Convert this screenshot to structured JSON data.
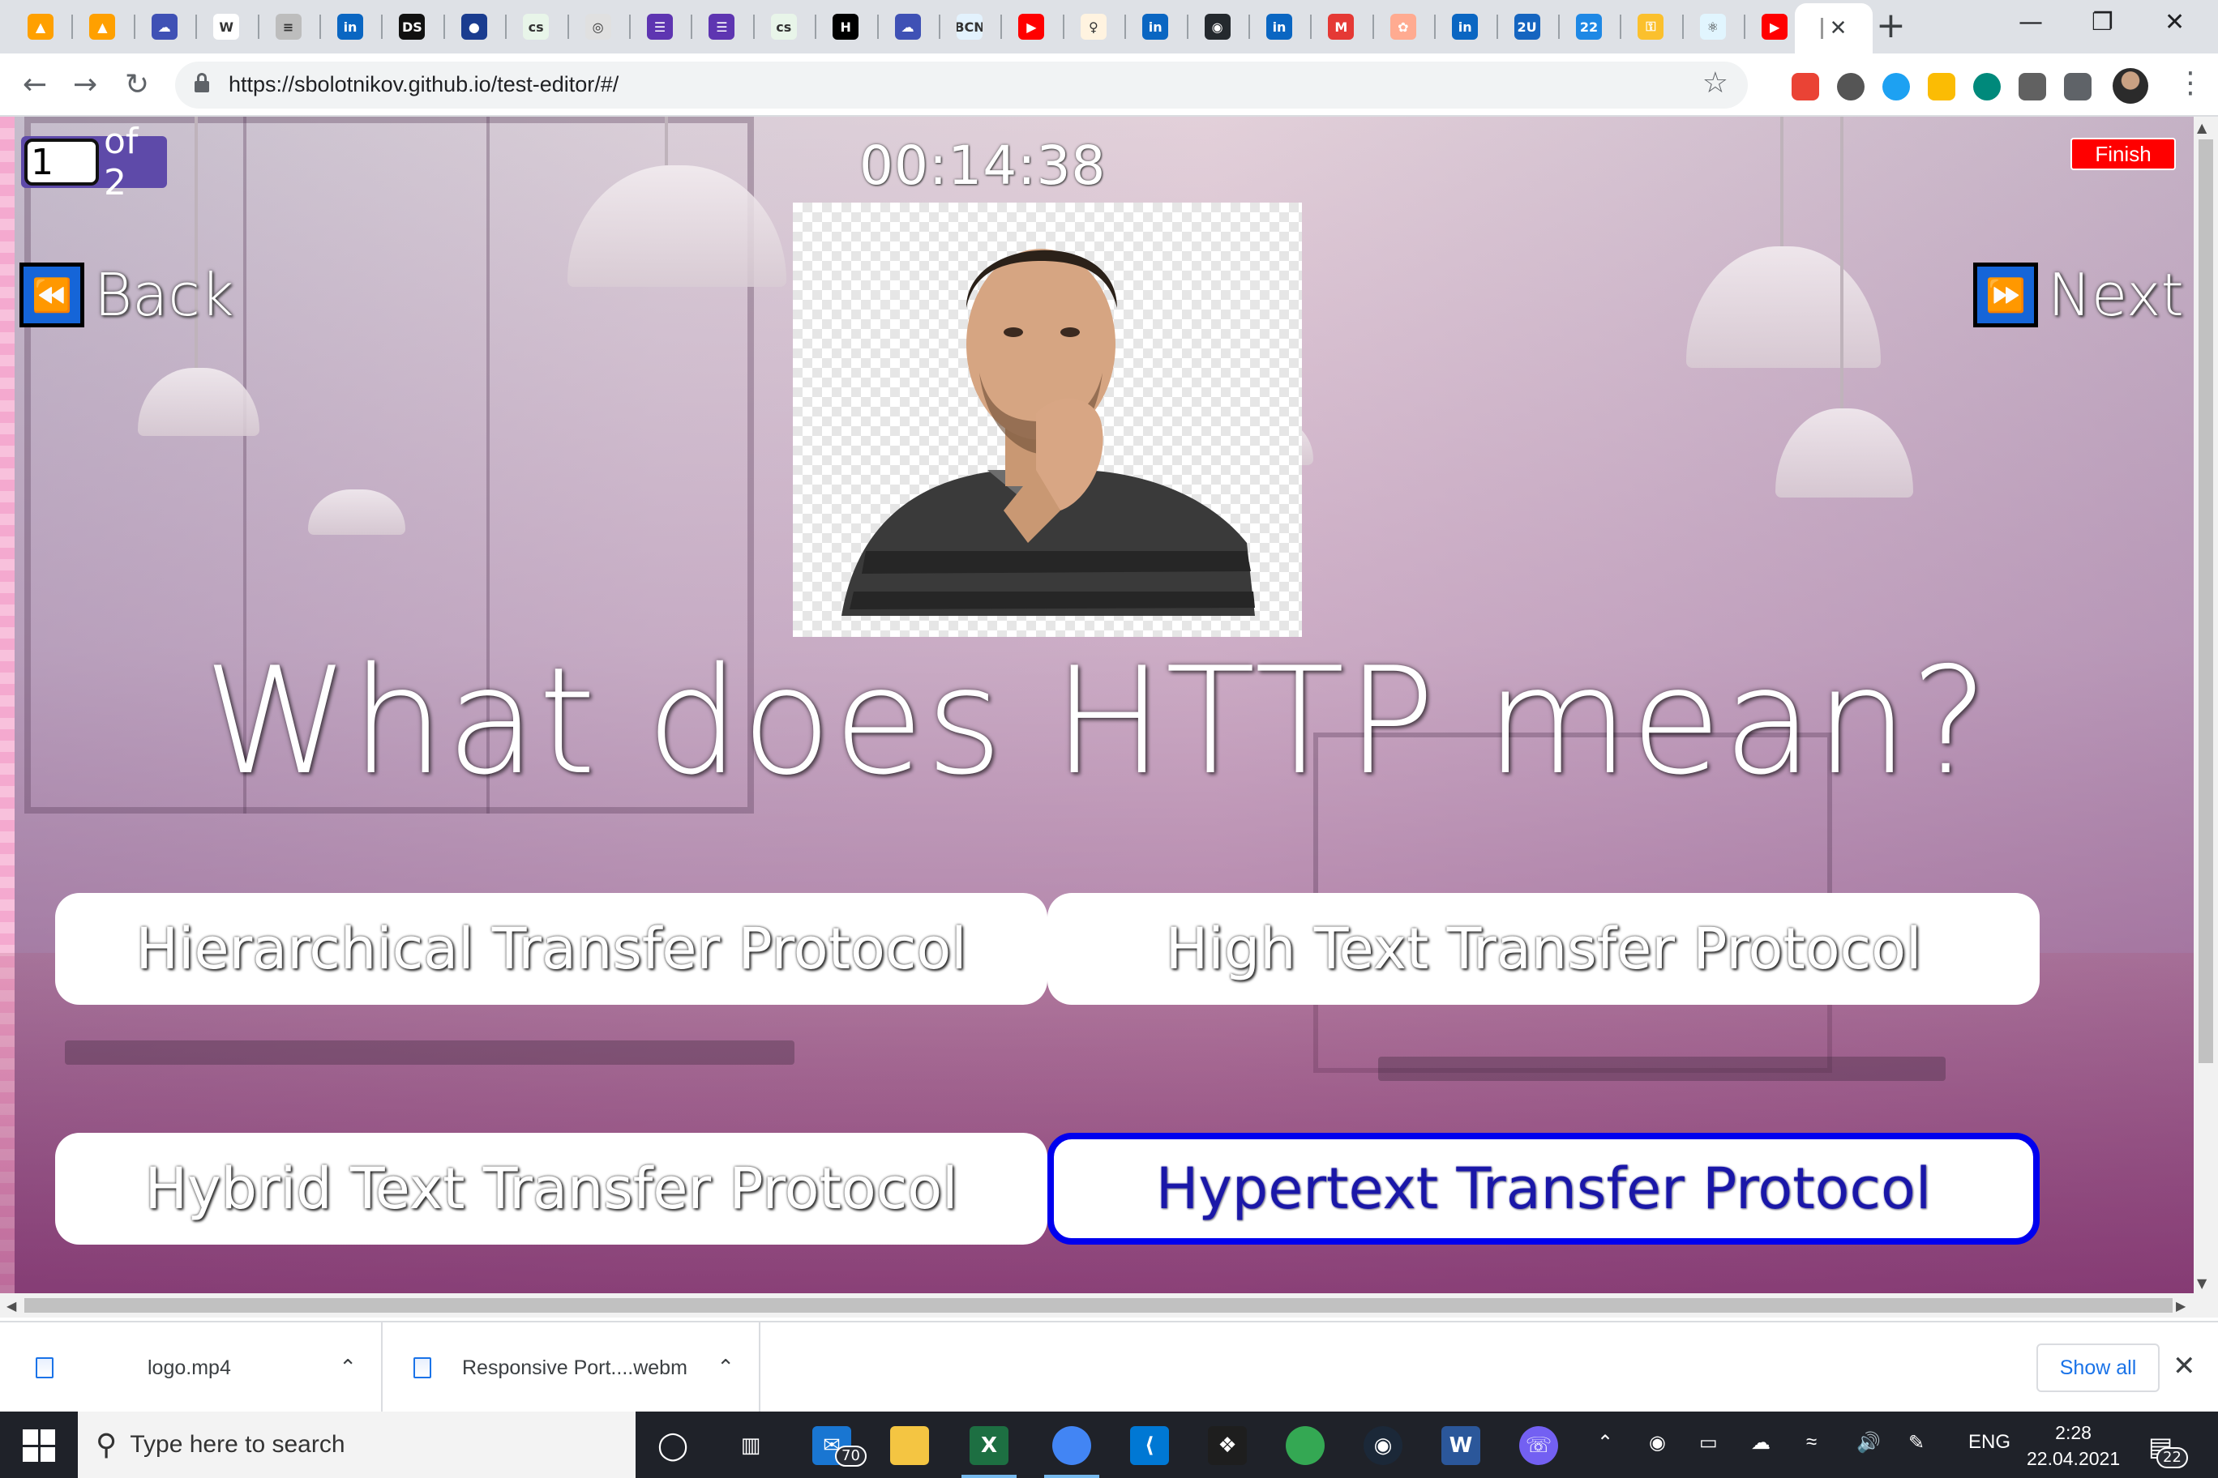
{
  "browser": {
    "tabs": [
      {
        "icon": "firebase-icon",
        "color": "#ffa000",
        "glyph": "▲"
      },
      {
        "icon": "firebase-icon",
        "color": "#ffa000",
        "glyph": "▲"
      },
      {
        "icon": "cloud-icon",
        "color": "#3f51b5",
        "glyph": "☁"
      },
      {
        "icon": "wikipedia-icon",
        "color": "#ffffff",
        "glyph": "W"
      },
      {
        "icon": "doc-icon",
        "color": "#bdbdbd",
        "glyph": "≡"
      },
      {
        "icon": "linkedin-icon",
        "color": "#0a66c2",
        "glyph": "in"
      },
      {
        "icon": "ds-icon",
        "color": "#111111",
        "glyph": "DS"
      },
      {
        "icon": "circle-icon",
        "color": "#1a3c8f",
        "glyph": "●"
      },
      {
        "icon": "cs-icon",
        "color": "#e8f5e9",
        "glyph": "cs"
      },
      {
        "icon": "badge-icon",
        "color": "#e0e0e0",
        "glyph": "◎"
      },
      {
        "icon": "list-icon",
        "color": "#5e35b1",
        "glyph": "☰"
      },
      {
        "icon": "list-icon",
        "color": "#5e35b1",
        "glyph": "☰"
      },
      {
        "icon": "cs-icon",
        "color": "#e8f5e9",
        "glyph": "cs"
      },
      {
        "icon": "hackernoon-icon",
        "color": "#000000",
        "glyph": "H"
      },
      {
        "icon": "cloud-icon",
        "color": "#3f51b5",
        "glyph": "☁"
      },
      {
        "icon": "bcn-icon",
        "color": "#e3f2fd",
        "glyph": "BCN"
      },
      {
        "icon": "youtube-icon",
        "color": "#ff0000",
        "glyph": "▶"
      },
      {
        "icon": "bottle-icon",
        "color": "#fff3e0",
        "glyph": "♀"
      },
      {
        "icon": "linkedin-icon",
        "color": "#0a66c2",
        "glyph": "in"
      },
      {
        "icon": "github-icon",
        "color": "#24292e",
        "glyph": "◉"
      },
      {
        "icon": "linkedin-icon",
        "color": "#0a66c2",
        "glyph": "in"
      },
      {
        "icon": "m-icon",
        "color": "#e53935",
        "glyph": "M"
      },
      {
        "icon": "peach-icon",
        "color": "#ffab91",
        "glyph": "✿"
      },
      {
        "icon": "linkedin-icon",
        "color": "#0a66c2",
        "glyph": "in"
      },
      {
        "icon": "2u-icon",
        "color": "#1565c0",
        "glyph": "2U"
      },
      {
        "icon": "calendar-icon",
        "color": "#1e88e5",
        "glyph": "22"
      },
      {
        "icon": "key-icon",
        "color": "#fbc02d",
        "glyph": "⚿"
      },
      {
        "icon": "react-icon",
        "color": "#e1f5fe",
        "glyph": "⚛"
      },
      {
        "icon": "youtube-icon",
        "color": "#ff0000",
        "glyph": "▶"
      }
    ],
    "new_tab": "+",
    "window_controls": {
      "minimize": "—",
      "restore": "❐",
      "close": "✕"
    },
    "nav": {
      "back": "←",
      "forward": "→",
      "reload": "↻"
    },
    "url": "https://sbolotnikov.github.io/test-editor/#/",
    "star": "☆",
    "extensions_menu": "⋮"
  },
  "quiz": {
    "question_number_value": "1",
    "of_label": "of 2",
    "timer": "00:14:38",
    "finish_label": "Finish",
    "back_label": "Back",
    "next_label": "Next",
    "back_icon": "⏪",
    "next_icon": "⏩",
    "question": "What does HTTP mean?",
    "answers": [
      {
        "label": "Hierarchical Transfer Protocol",
        "selected": false
      },
      {
        "label": "High Text Transfer Protocol",
        "selected": false
      },
      {
        "label": "Hybrid Text Transfer Protocol",
        "selected": false
      },
      {
        "label": "Hypertext Transfer Protocol",
        "selected": true
      }
    ],
    "accent_color": "#0000ee",
    "finish_color": "#ff0000"
  },
  "downloads": {
    "items": [
      {
        "name": "logo.mp4"
      },
      {
        "name": "Responsive Port....webm"
      }
    ],
    "show_all_label": "Show all",
    "close": "✕"
  },
  "taskbar": {
    "search_placeholder": "Type here to search",
    "mail_badge": "70",
    "language": "ENG",
    "time": "2:28",
    "date": "22.04.2021",
    "notifications_badge": "22"
  }
}
